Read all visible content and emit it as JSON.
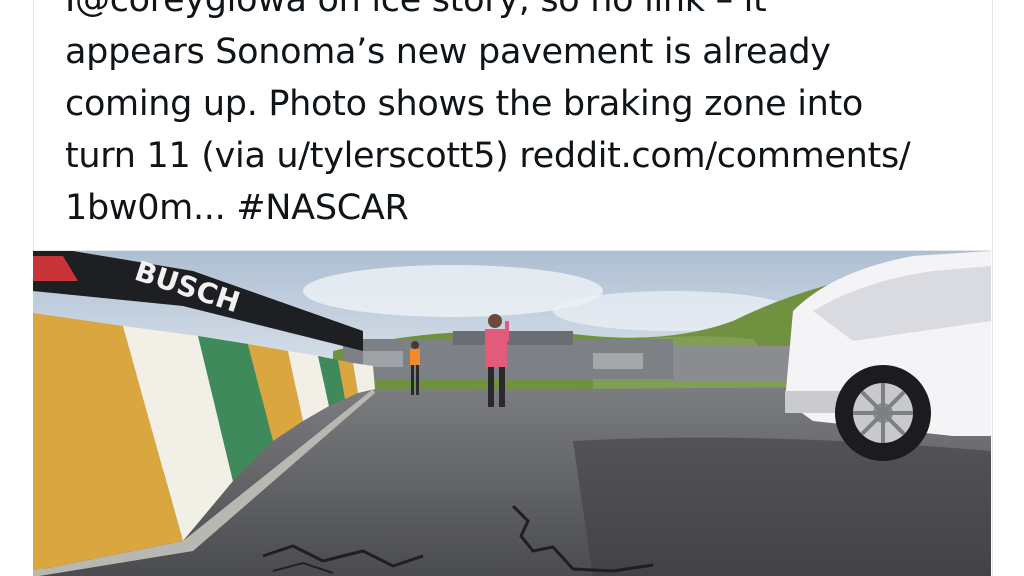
{
  "tweet": {
    "lines": [
      "I@coreyglowa on ice story, so no link – it",
      "appears Sonoma’s new pavement is already",
      "coming up. Photo shows the braking zone into",
      "turn 11 (via u/tylerscott5) reddit.com/comments/",
      "1bw0m... #NASCAR"
    ]
  },
  "photo": {
    "signage_text": "BUSCH",
    "sky_color": "#c9d6e4",
    "hill_color": "#5f8a3a",
    "asphalt_color": "#5b5d62",
    "wall_colors": [
      "#d9a640",
      "#f2efe6",
      "#3f8a5a",
      "#d9a640",
      "#f2efe6",
      "#3f8a5a",
      "#d9a640",
      "#f2efe6"
    ],
    "truck_color": "#f4f4f6"
  }
}
